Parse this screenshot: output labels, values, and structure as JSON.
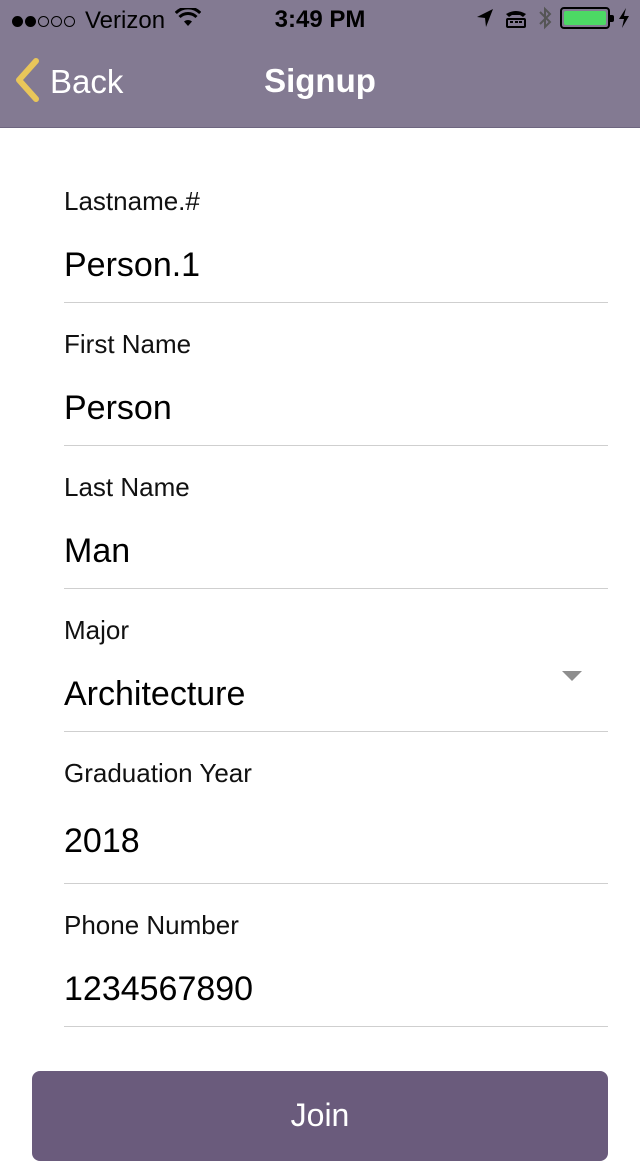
{
  "status_bar": {
    "signal_filled": 2,
    "signal_total": 5,
    "carrier": "Verizon",
    "time": "3:49 PM",
    "icons": [
      "wifi-icon",
      "location-icon",
      "tty-icon",
      "bluetooth-icon",
      "battery-icon",
      "charging-icon"
    ],
    "battery_level": 1.0,
    "battery_color": "#4cd964"
  },
  "nav": {
    "back_label": "Back",
    "title": "Signup",
    "back_icon": "chevron-left-icon",
    "back_icon_color": "#e9c65a",
    "bar_color": "#837a92"
  },
  "form": {
    "fields": [
      {
        "label": "Lastname.#",
        "value": "Person.1"
      },
      {
        "label": "First Name",
        "value": "Person"
      },
      {
        "label": "Last Name",
        "value": "Man"
      },
      {
        "label": "Major",
        "value": "Architecture",
        "dropdown_icon": "caret-down-icon"
      },
      {
        "label": "Graduation Year",
        "value": "2018"
      },
      {
        "label": "Phone Number",
        "value": "1234567890"
      }
    ]
  },
  "join_button": {
    "label": "Join",
    "color": "#6a5b7c"
  }
}
